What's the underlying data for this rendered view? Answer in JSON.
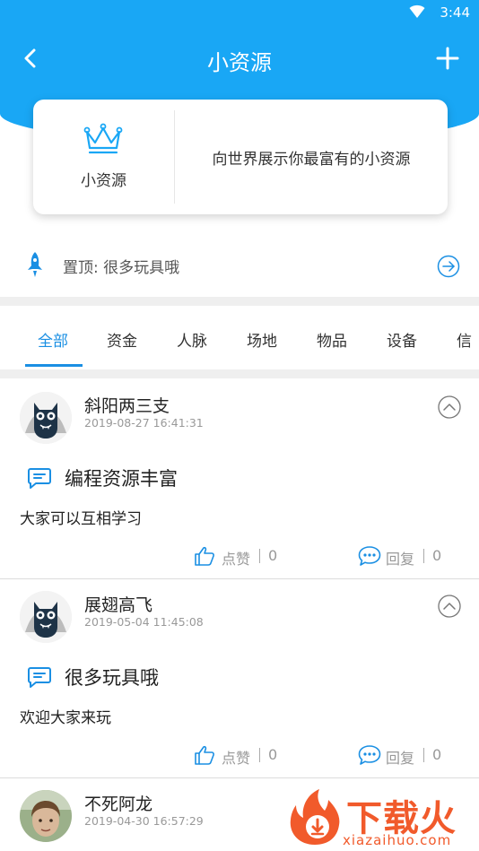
{
  "status_bar": {
    "time": "3:44"
  },
  "header": {
    "title": "小资源"
  },
  "card": {
    "name": "小资源",
    "description": "向世界展示你最富有的小资源"
  },
  "pinned": {
    "text": "置顶: 很多玩具哦"
  },
  "tabs": [
    {
      "label": "全部",
      "active": true
    },
    {
      "label": "资金"
    },
    {
      "label": "人脉"
    },
    {
      "label": "场地"
    },
    {
      "label": "物品"
    },
    {
      "label": "设备"
    },
    {
      "label": "信"
    }
  ],
  "posts": [
    {
      "user": "斜阳两三支",
      "time": "2019-08-27 16:41:31",
      "title": "编程资源丰富",
      "body": "大家可以互相学习",
      "like_label": "点赞",
      "like_count": "0",
      "reply_label": "回复",
      "reply_count": "0"
    },
    {
      "user": "展翅高飞",
      "time": "2019-05-04 11:45:08",
      "title": "很多玩具哦",
      "body": "欢迎大家来玩",
      "like_label": "点赞",
      "like_count": "0",
      "reply_label": "回复",
      "reply_count": "0"
    },
    {
      "user": "不死阿龙",
      "time": "2019-04-30 16:57:29"
    }
  ],
  "watermark": {
    "brand": "下载火",
    "url": "xiazaihuo.com"
  },
  "colors": {
    "primary": "#19a7f5",
    "tab_active": "#1a8fe3",
    "icon_blue": "#1a8fe3",
    "brand_orange": "#f15a2b"
  }
}
